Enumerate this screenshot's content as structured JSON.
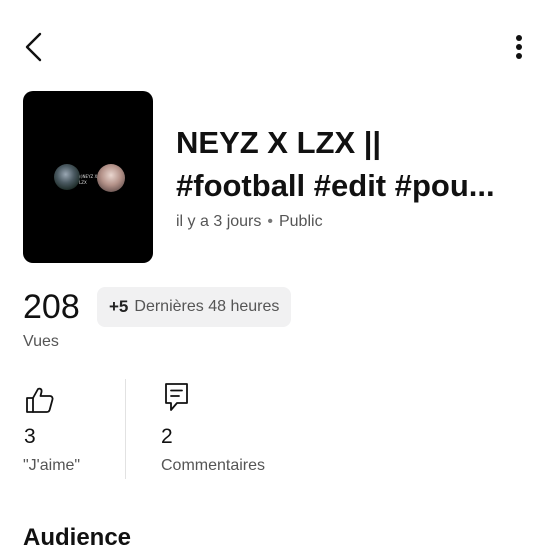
{
  "header": {
    "back_icon": "chevron-left-icon",
    "menu_icon": "more-vertical-icon"
  },
  "video": {
    "thumbnail_text": "ﾐ)NEYZ X LZX",
    "title_line1": "NEYZ X LZX ||",
    "title_line2": "#football #edit #pou...",
    "posted": "il y a 3 jours",
    "separator": "•",
    "visibility": "Public"
  },
  "views": {
    "count": "208",
    "delta": "+5",
    "delta_period": "Dernières 48 heures",
    "label": "Vues"
  },
  "engagement": {
    "likes_icon": "thumbs-up-icon",
    "likes_count": "3",
    "likes_label": "\"J'aime\"",
    "comments_icon": "comment-icon",
    "comments_count": "2",
    "comments_label": "Commentaires"
  },
  "sections": {
    "audience_title": "Audience"
  },
  "colors": {
    "text_primary": "#111111",
    "text_secondary": "#555555",
    "badge_bg": "#f1f1f2",
    "thumbnail_bg": "#000000"
  }
}
